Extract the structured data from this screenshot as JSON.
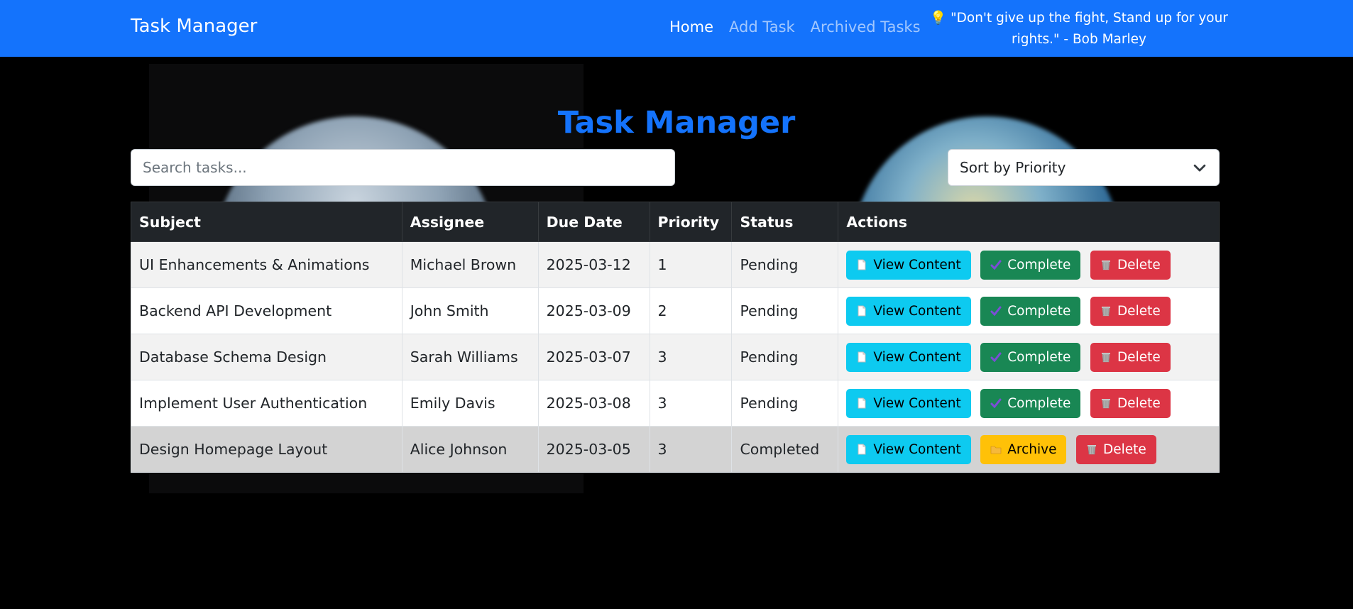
{
  "navbar": {
    "brand": "Task Manager",
    "links": [
      "Home",
      "Add Task",
      "Archived Tasks"
    ],
    "quote": "\"Don't give up the fight, Stand up for your rights.\" - Bob Marley"
  },
  "main": {
    "title": "Task Manager",
    "search_placeholder": "Search tasks...",
    "sort_label": "Sort by Priority"
  },
  "table": {
    "headers": [
      "Subject",
      "Assignee",
      "Due Date",
      "Priority",
      "Status",
      "Actions"
    ],
    "rows": [
      {
        "subject": "UI Enhancements & Animations",
        "assignee": "Michael Brown",
        "due": "2025-03-12",
        "priority": "1",
        "status": "Pending",
        "actions": [
          "View Content",
          "Complete",
          "Delete"
        ]
      },
      {
        "subject": "Backend API Development",
        "assignee": "John Smith",
        "due": "2025-03-09",
        "priority": "2",
        "status": "Pending",
        "actions": [
          "View Content",
          "Complete",
          "Delete"
        ]
      },
      {
        "subject": "Database Schema Design",
        "assignee": "Sarah Williams",
        "due": "2025-03-07",
        "priority": "3",
        "status": "Pending",
        "actions": [
          "View Content",
          "Complete",
          "Delete"
        ]
      },
      {
        "subject": "Implement User Authentication",
        "assignee": "Emily Davis",
        "due": "2025-03-08",
        "priority": "3",
        "status": "Pending",
        "actions": [
          "View Content",
          "Complete",
          "Delete"
        ]
      },
      {
        "subject": "Design Homepage Layout",
        "assignee": "Alice Johnson",
        "due": "2025-03-05",
        "priority": "3",
        "status": "Completed",
        "actions": [
          "View Content",
          "Archive",
          "Delete"
        ]
      }
    ]
  },
  "colors": {
    "primary": "#1473fc",
    "info": "#0dcaf0",
    "success": "#198754",
    "danger": "#dc3545",
    "warning": "#ffc107"
  },
  "icons": {
    "quote": "lightbulb-icon",
    "sort": "chevron-down-icon",
    "view": "document-icon",
    "complete": "check-icon",
    "delete": "trash-icon",
    "archive": "folder-icon"
  }
}
